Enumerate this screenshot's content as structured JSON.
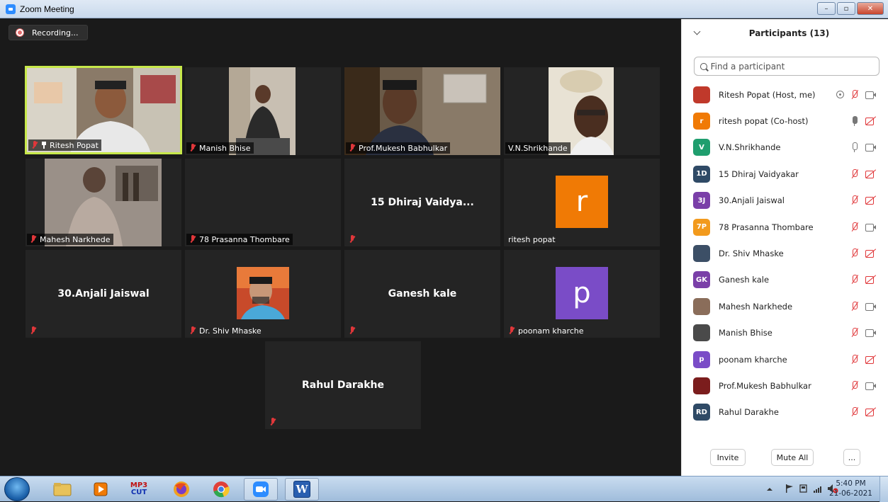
{
  "window": {
    "title": "Zoom Meeting",
    "controls": {
      "minimize": "–",
      "maximize": "▫",
      "close": "✕"
    }
  },
  "meeting": {
    "recording_label": "Recording...",
    "tiles": [
      {
        "name": "Ritesh Popat",
        "pinned": true,
        "muted": true,
        "type": "video"
      },
      {
        "name": "Manish Bhise",
        "muted": true,
        "type": "video"
      },
      {
        "name": "Prof.Mukesh Babhulkar",
        "muted": true,
        "type": "video"
      },
      {
        "name": "V.N.Shrikhande",
        "muted": false,
        "type": "video"
      },
      {
        "name": "Mahesh Narkhede",
        "muted": true,
        "type": "video"
      },
      {
        "name": "78 Prasanna Thombare",
        "muted": true,
        "type": "name"
      },
      {
        "center_name": "15 Dhiraj Vaidya...",
        "muted": true,
        "type": "name"
      },
      {
        "name": "ritesh popat",
        "muted": false,
        "type": "avatar",
        "avatar_letter": "r",
        "avatar_color": "#f07a05"
      },
      {
        "center_name": "30.Anjali Jaiswal",
        "muted": true,
        "type": "name"
      },
      {
        "name": "Dr. Shiv Mhaske",
        "muted": true,
        "type": "photo"
      },
      {
        "center_name": "Ganesh kale",
        "muted": true,
        "type": "name"
      },
      {
        "name": "poonam kharche",
        "muted": true,
        "type": "avatar",
        "avatar_letter": "p",
        "avatar_color": "#7a4cc7"
      },
      {
        "center_name": "Rahul Darakhe",
        "muted": true,
        "type": "name"
      }
    ]
  },
  "participants": {
    "title": "Participants (13)",
    "search_placeholder": "Find a participant",
    "list": [
      {
        "name": "Ritesh Popat (Host, me)",
        "initials": "",
        "color": "#c0392b",
        "photo": true,
        "share": true,
        "mic": "off",
        "cam": "on"
      },
      {
        "name": "ritesh popat (Co-host)",
        "initials": "r",
        "color": "#f07a05",
        "mic": "on-active",
        "cam": "off"
      },
      {
        "name": "V.N.Shrikhande",
        "initials": "V",
        "color": "#1f9e6e",
        "mic": "on",
        "cam": "on"
      },
      {
        "name": "15 Dhiraj Vaidyakar",
        "initials": "1D",
        "color": "#2f4a66",
        "mic": "off",
        "cam": "off"
      },
      {
        "name": "30.Anjali Jaiswal",
        "initials": "3J",
        "color": "#7a3fa8",
        "mic": "off",
        "cam": "off"
      },
      {
        "name": "78 Prasanna Thombare",
        "initials": "7P",
        "color": "#f29a1d",
        "mic": "off",
        "cam": "on"
      },
      {
        "name": "Dr. Shiv Mhaske",
        "initials": "",
        "color": "#3c4f66",
        "photo": true,
        "mic": "off",
        "cam": "off"
      },
      {
        "name": "Ganesh kale",
        "initials": "GK",
        "color": "#7a3fa8",
        "mic": "off",
        "cam": "off"
      },
      {
        "name": "Mahesh Narkhede",
        "initials": "",
        "color": "#8a6d5a",
        "photo": true,
        "mic": "off",
        "cam": "on"
      },
      {
        "name": "Manish Bhise",
        "initials": "",
        "color": "#4a4a4a",
        "photo": true,
        "mic": "off",
        "cam": "on"
      },
      {
        "name": "poonam kharche",
        "initials": "p",
        "color": "#7a4cc7",
        "mic": "off",
        "cam": "off"
      },
      {
        "name": "Prof.Mukesh Babhulkar",
        "initials": "",
        "color": "#7b1d1d",
        "photo": true,
        "mic": "off",
        "cam": "on"
      },
      {
        "name": "Rahul Darakhe",
        "initials": "RD",
        "color": "#2f4a66",
        "mic": "off",
        "cam": "off"
      }
    ],
    "footer": {
      "invite": "Invite",
      "mute_all": "Mute All",
      "more": "..."
    }
  },
  "taskbar": {
    "apps": [
      "start-orb",
      "file-explorer",
      "media-player",
      "mp3-cutter",
      "firefox",
      "chrome",
      "zoom",
      "word"
    ],
    "mp3_label_top": "MP3",
    "mp3_label_bottom": "CUT",
    "word_label": "W",
    "clock_time": "5:40 PM",
    "clock_date": "21-06-2021"
  }
}
